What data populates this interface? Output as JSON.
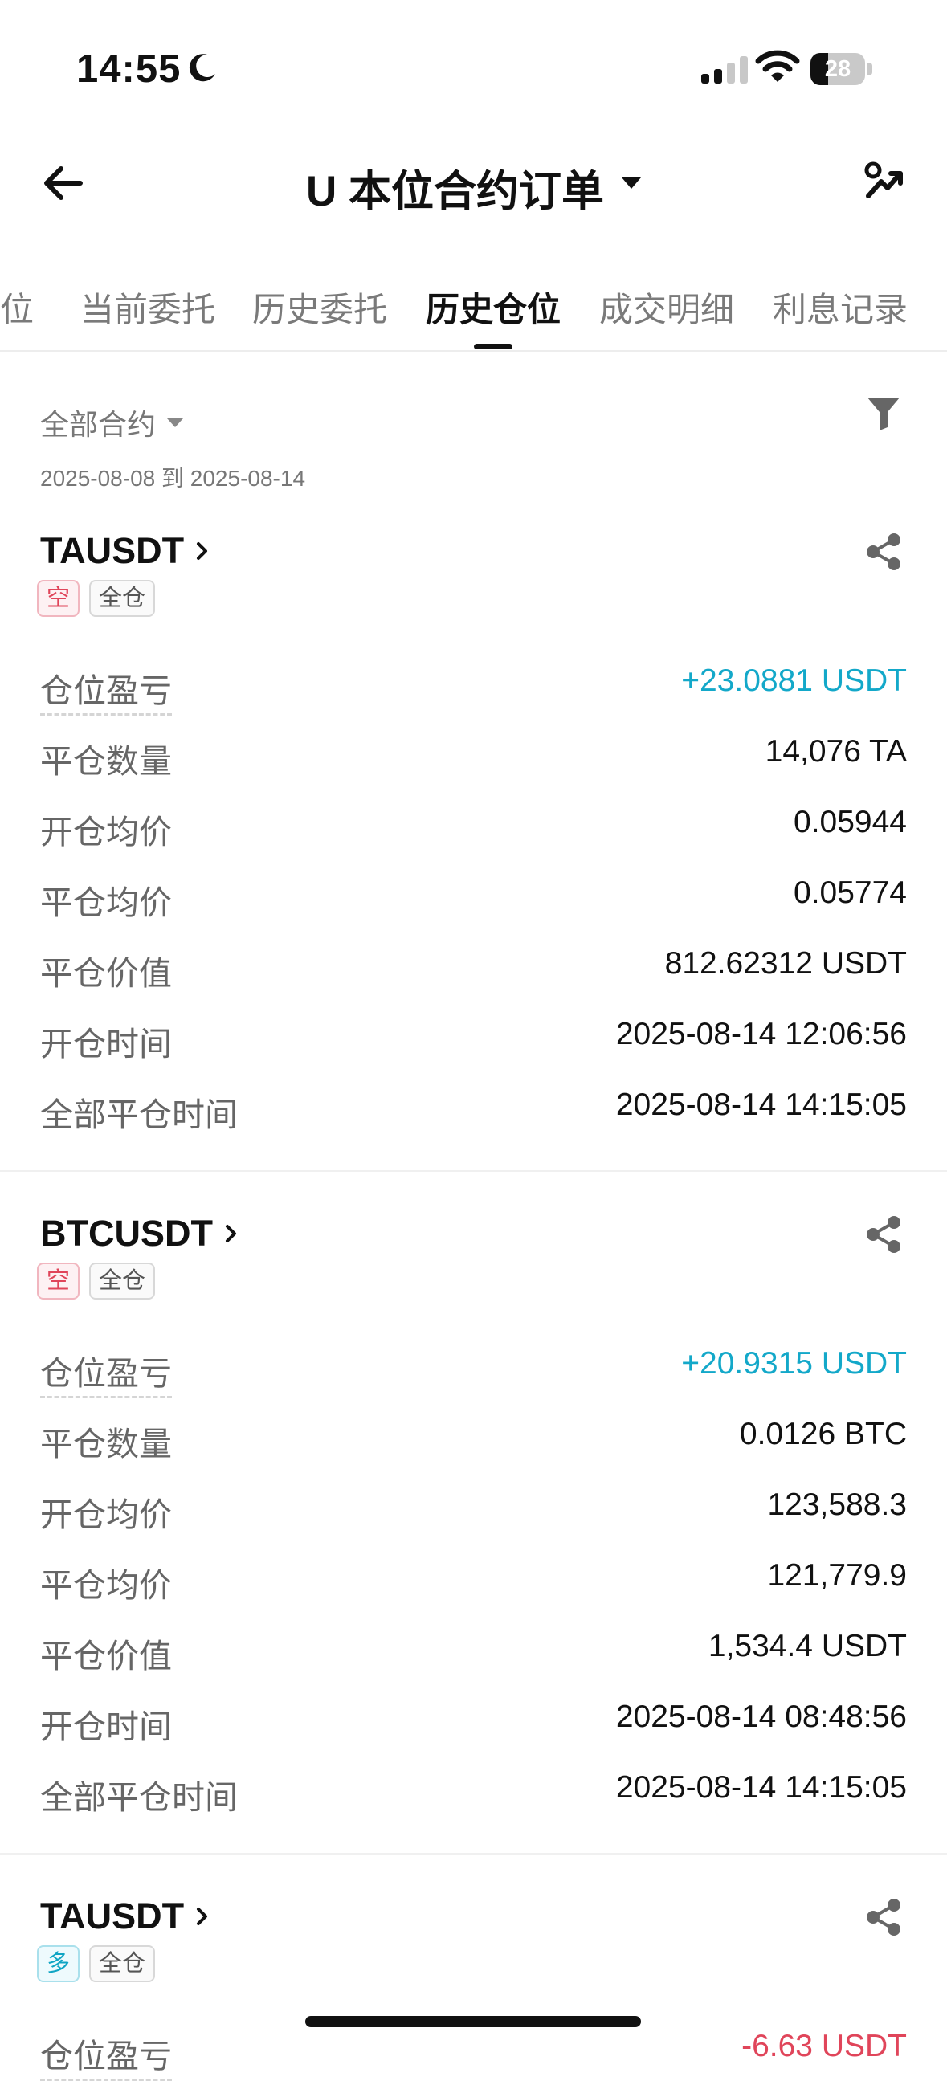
{
  "status_bar": {
    "time": "14:55",
    "battery": "28"
  },
  "header": {
    "title": "U 本位合约订单"
  },
  "tabs": [
    {
      "label": "仓位"
    },
    {
      "label": "当前委托"
    },
    {
      "label": "历史委托"
    },
    {
      "label": "历史仓位"
    },
    {
      "label": "成交明细"
    },
    {
      "label": "利息记录"
    }
  ],
  "active_tab": "历史仓位",
  "filter": {
    "contract": "全部合约",
    "date_range": "2025-08-08 到 2025-08-14"
  },
  "labels": {
    "pnl": "仓位盈亏",
    "close_qty": "平仓数量",
    "open_avg": "开仓均价",
    "close_avg": "平仓均价",
    "close_value": "平仓价值",
    "open_time": "开仓时间",
    "close_time": "全部平仓时间"
  },
  "positions": [
    {
      "symbol": "TAUSDT",
      "side": "空",
      "margin_mode": "全仓",
      "pnl": "+23.0881 USDT",
      "close_qty": "14,076 TA",
      "open_avg": "0.05944",
      "close_avg": "0.05774",
      "close_value": "812.62312 USDT",
      "open_time": "2025-08-14 12:06:56",
      "close_time": "2025-08-14 14:15:05"
    },
    {
      "symbol": "BTCUSDT",
      "side": "空",
      "margin_mode": "全仓",
      "pnl": "+20.9315 USDT",
      "close_qty": "0.0126 BTC",
      "open_avg": "123,588.3",
      "close_avg": "121,779.9",
      "close_value": "1,534.4 USDT",
      "open_time": "2025-08-14 08:48:56",
      "close_time": "2025-08-14 14:15:05"
    },
    {
      "symbol": "TAUSDT",
      "side": "多",
      "margin_mode": "全仓",
      "pnl": "-6.63 USDT"
    }
  ],
  "colors": {
    "profit": "#13a8c9",
    "loss": "#e0455a",
    "text": "#111111",
    "muted": "#666666"
  }
}
